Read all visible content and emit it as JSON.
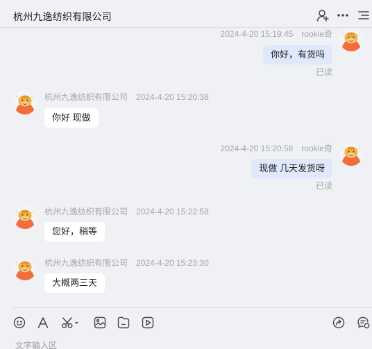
{
  "header": {
    "title": "杭州九逸纺织有限公司",
    "icons": [
      "add-contact-icon",
      "more-icon",
      "menu-icon"
    ]
  },
  "messages": [
    {
      "direction": "out",
      "name": "rookie奇",
      "time": "2024-4-20 15:19:45",
      "text": "你好，有货吗",
      "status": "已读"
    },
    {
      "direction": "in",
      "name": "杭州九逸纺织有限公司",
      "time": "2024-4-20 15:20:38",
      "text": "你好 现做"
    },
    {
      "direction": "out",
      "name": "rookie奇",
      "time": "2024-4-20 15:20:58",
      "text": "现做 几天发货呀",
      "status": "已读"
    },
    {
      "direction": "in",
      "name": "杭州九逸纺织有限公司",
      "time": "2024-4-20 15:22:58",
      "text": "您好，稍等"
    },
    {
      "direction": "in",
      "name": "杭州九逸纺织有限公司",
      "time": "2024-4-20 15:23:30",
      "text": "大概两三天"
    }
  ],
  "toolbar": {
    "icons": [
      "emoji-icon",
      "font-icon",
      "scissors-icon",
      "image-icon",
      "file-icon",
      "video-icon",
      "share-icon",
      "quick-reply-icon"
    ]
  },
  "input": {
    "placeholder": "文字输入区"
  },
  "colors": {
    "background": "#f0f1f5",
    "bubble_out": "#e0e9fb",
    "bubble_in": "#ffffff",
    "avatar_orange": "#f26d3d",
    "muted_text": "#a3a5ab"
  }
}
